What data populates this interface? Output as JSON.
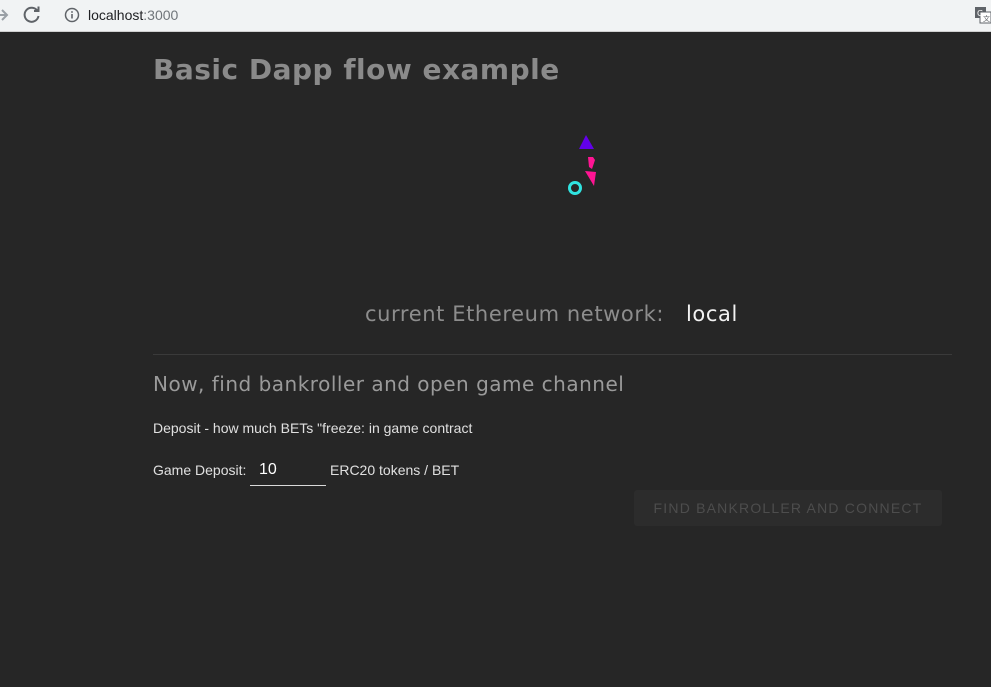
{
  "browser": {
    "url_host": "localhost",
    "url_port": ":3000"
  },
  "page": {
    "title": "Basic Dapp flow example",
    "network_label": "current Ethereum network:",
    "network_value": "local",
    "section_heading": "Now, find bankroller and open game channel",
    "deposit_description": "Deposit - how much BETs \"freeze: in game contract",
    "deposit_label": "Game Deposit:",
    "deposit_value": "10",
    "deposit_unit": "ERC20 tokens / BET",
    "connect_button_label": "FIND BANKROLLER AND CONNECT"
  },
  "colors": {
    "background": "#262626",
    "logo_triangle": "#6200ea",
    "logo_shape": "#ff1493",
    "logo_circle": "#30e3e0"
  }
}
